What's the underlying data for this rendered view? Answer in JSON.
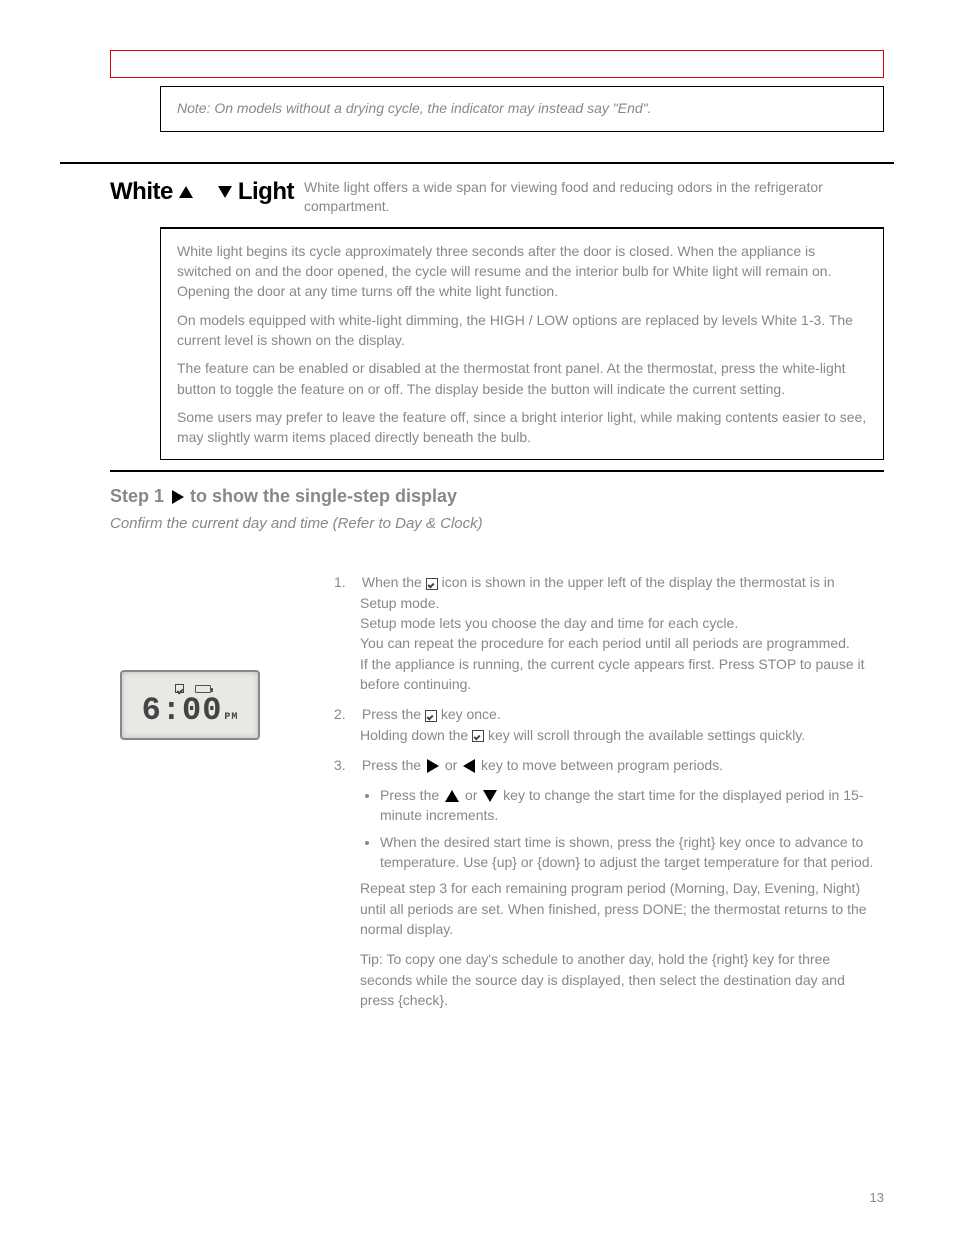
{
  "warning_box": "",
  "note_box": "Note: On models without a drying cycle, the indicator may instead say \"End\".",
  "white_section": {
    "title": "White ",
    "subtitle": " Light",
    "desc": "White light offers a wide span for viewing food and reducing odors in the refrigerator compartment.",
    "body_paragraphs": [
      "White light begins its cycle approximately three seconds after the door is closed. When the appliance is switched on and the door opened, the cycle will resume and the interior bulb for White light will remain on. Opening the door at any time turns off the white light function.",
      "On models equipped with white-light dimming, the HIGH / LOW options are replaced by levels White 1-3. The current level is shown on the display.",
      "The feature can be enabled or disabled at the thermostat front panel. At the thermostat, press the white-light button to toggle the feature on or off. The display beside the button will indicate the current setting.",
      "Some users may prefer to leave the feature off, since a bright interior light, while making contents easier to see, may slightly warm items placed directly beneath the bulb."
    ]
  },
  "single_step": {
    "label": "Step 1",
    "step_text": " to show the single-step display",
    "sub_text": "Confirm the current day and time (Refer to Day & Clock)"
  },
  "lcd": {
    "time": "6:00",
    "ampm": "PM"
  },
  "steps": [
    {
      "n": "1.",
      "lines": [
        "When the {check} icon is shown in the upper left of the display the thermostat is in Setup mode.",
        "Setup mode lets you choose the day and time for each cycle.",
        "You can repeat the procedure for each period until all periods are programmed.",
        "If the appliance is running, the current cycle appears first. Press STOP to pause it before continuing."
      ]
    },
    {
      "n": "2.",
      "lines": [
        "Press the {check} key once.",
        "Holding down the {check} key will scroll through the available settings quickly.",
        ""
      ]
    },
    {
      "n": "3.",
      "lines": [
        "Press the {right} or {left} key to move between program periods.",
        "Press the {up} or {down} key to change the start time for the displayed period in 15-minute increments.",
        "When the desired start time is shown, press the {right} key once to advance to temperature. Use {up} or {down} to adjust the target temperature for that period."
      ]
    }
  ],
  "repeat": "Repeat step 3 for each remaining program period (Morning, Day, Evening, Night) until all periods are set. When finished, press DONE; the thermostat returns to the normal display.",
  "tip": "Tip: To copy one day's schedule to another day, hold the {right} key for three seconds while the source day is displayed, then select the destination day and press {check}.",
  "page": "13"
}
